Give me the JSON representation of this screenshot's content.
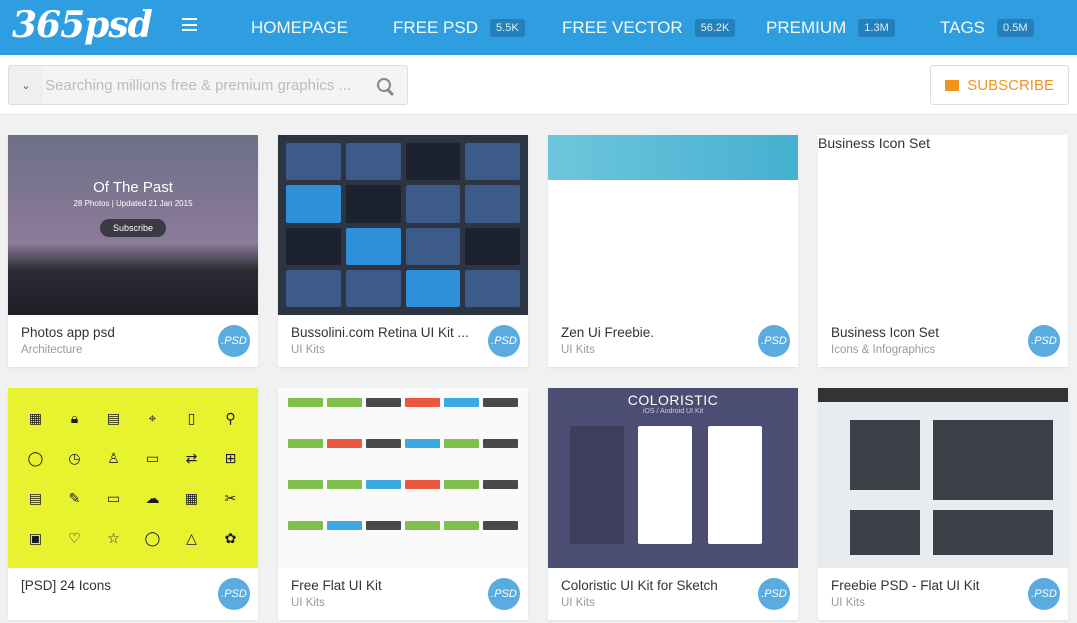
{
  "header": {
    "logo": "365psd",
    "nav": [
      {
        "label": "HOMEPAGE"
      },
      {
        "label": "FREE PSD",
        "count": "5.5K"
      },
      {
        "label": "FREE VECTOR",
        "count": "56.2K"
      },
      {
        "label": "PREMIUM",
        "count": "1.3M"
      },
      {
        "label": "TAGS",
        "count": "0.5M"
      }
    ]
  },
  "search": {
    "placeholder": "Searching millions free & premium graphics ..."
  },
  "subscribe": {
    "label": "SUBSCRIBE"
  },
  "accent": "#2f9ee0",
  "cards": [
    {
      "title": "Photos app psd",
      "category": "Architecture",
      "badge": ".PSD",
      "thumb": {
        "heading": "Of The Past",
        "sub": "28 Photos | Updated 21 Jan 2015",
        "button": "Subscribe"
      }
    },
    {
      "title": "Bussolini.com Retina UI Kit ...",
      "category": "UI Kits",
      "badge": ".PSD"
    },
    {
      "title": "Zen Ui Freebie.",
      "category": "UI Kits",
      "badge": ".PSD"
    },
    {
      "title": "Business Icon Set",
      "category": "Icons & Infographics",
      "badge": ".PSD",
      "thumb": {
        "heading": "Business Icon Set"
      }
    },
    {
      "title": "[PSD] 24 Icons",
      "category": "",
      "badge": ".PSD"
    },
    {
      "title": "Free Flat UI Kit",
      "category": "UI Kits",
      "badge": ".PSD"
    },
    {
      "title": "Coloristic UI Kit for Sketch",
      "category": "UI Kits",
      "badge": ".PSD",
      "thumb": {
        "heading": "COLORISTIC",
        "sub": "iOS / Android UI Kit"
      }
    },
    {
      "title": "Freebie PSD - Flat UI Kit",
      "category": "UI Kits",
      "badge": ".PSD"
    }
  ]
}
